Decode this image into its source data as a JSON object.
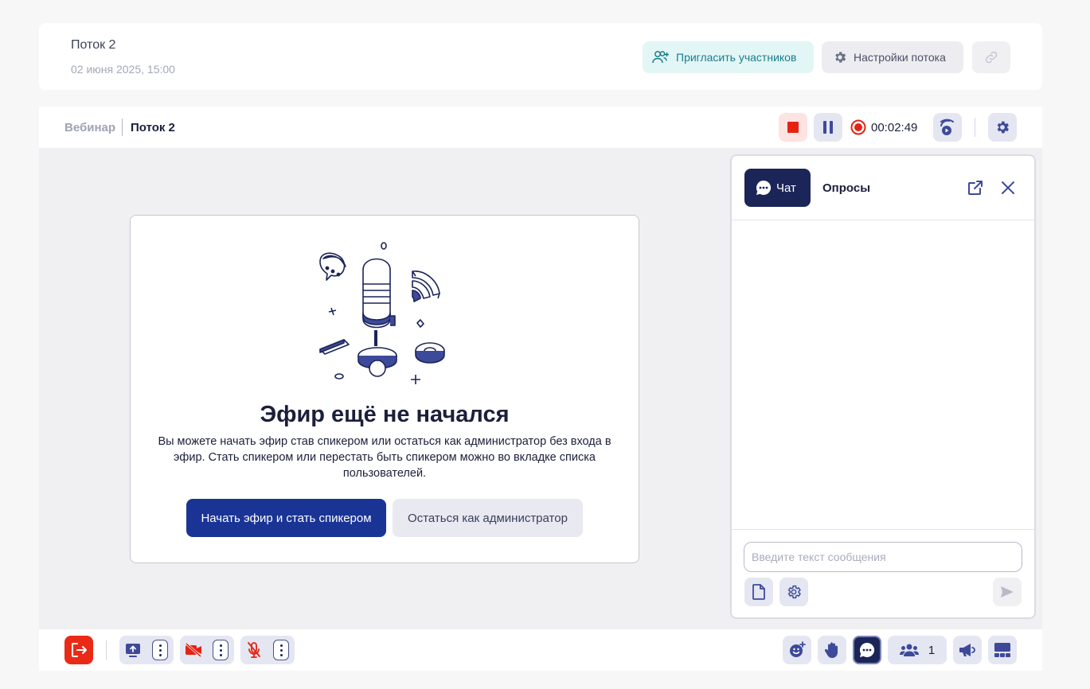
{
  "stream": {
    "title": "Поток 2",
    "date": "02 июня 2025, 15:00",
    "invite_label": "Пригласить участников",
    "settings_label": "Настройки потока"
  },
  "breadcrumb": {
    "parent": "Вебинар",
    "current": "Поток 2"
  },
  "recording": {
    "timer": "00:02:49"
  },
  "notice": {
    "title": "Эфир ещё не начался",
    "text": "Вы можете начать эфир став спикером или остаться как администратор без входа в эфир. Стать спикером или перестать быть спикером можно во вкладке списка пользователей.",
    "start_label": "Начать эфир и стать спикером",
    "admin_label": "Остаться как администратор"
  },
  "chat": {
    "tabs": [
      {
        "label": "Чат",
        "active": true
      },
      {
        "label": "Опросы",
        "active": false
      }
    ],
    "input_placeholder": "Введите текст сообщения",
    "input_value": ""
  },
  "footer": {
    "participants_count": "1"
  },
  "colors": {
    "accent": "#1a3496",
    "dark_navy": "#1b2558",
    "danger": "#ea2a17",
    "teal": "#1a7c8f",
    "light_button": "#e4e6f2"
  },
  "icons": [
    "add-user-icon",
    "gear-icon",
    "link-icon",
    "stop-icon",
    "pause-icon",
    "record-icon",
    "broadcast-icon",
    "chat-bubble-icon",
    "external-link-icon",
    "close-icon",
    "file-icon",
    "send-icon",
    "exit-icon",
    "screen-share-icon",
    "camera-off-icon",
    "mic-off-icon",
    "kebab-icon",
    "emoji-add-icon",
    "hand-icon",
    "users-icon",
    "megaphone-icon",
    "layout-icon"
  ]
}
